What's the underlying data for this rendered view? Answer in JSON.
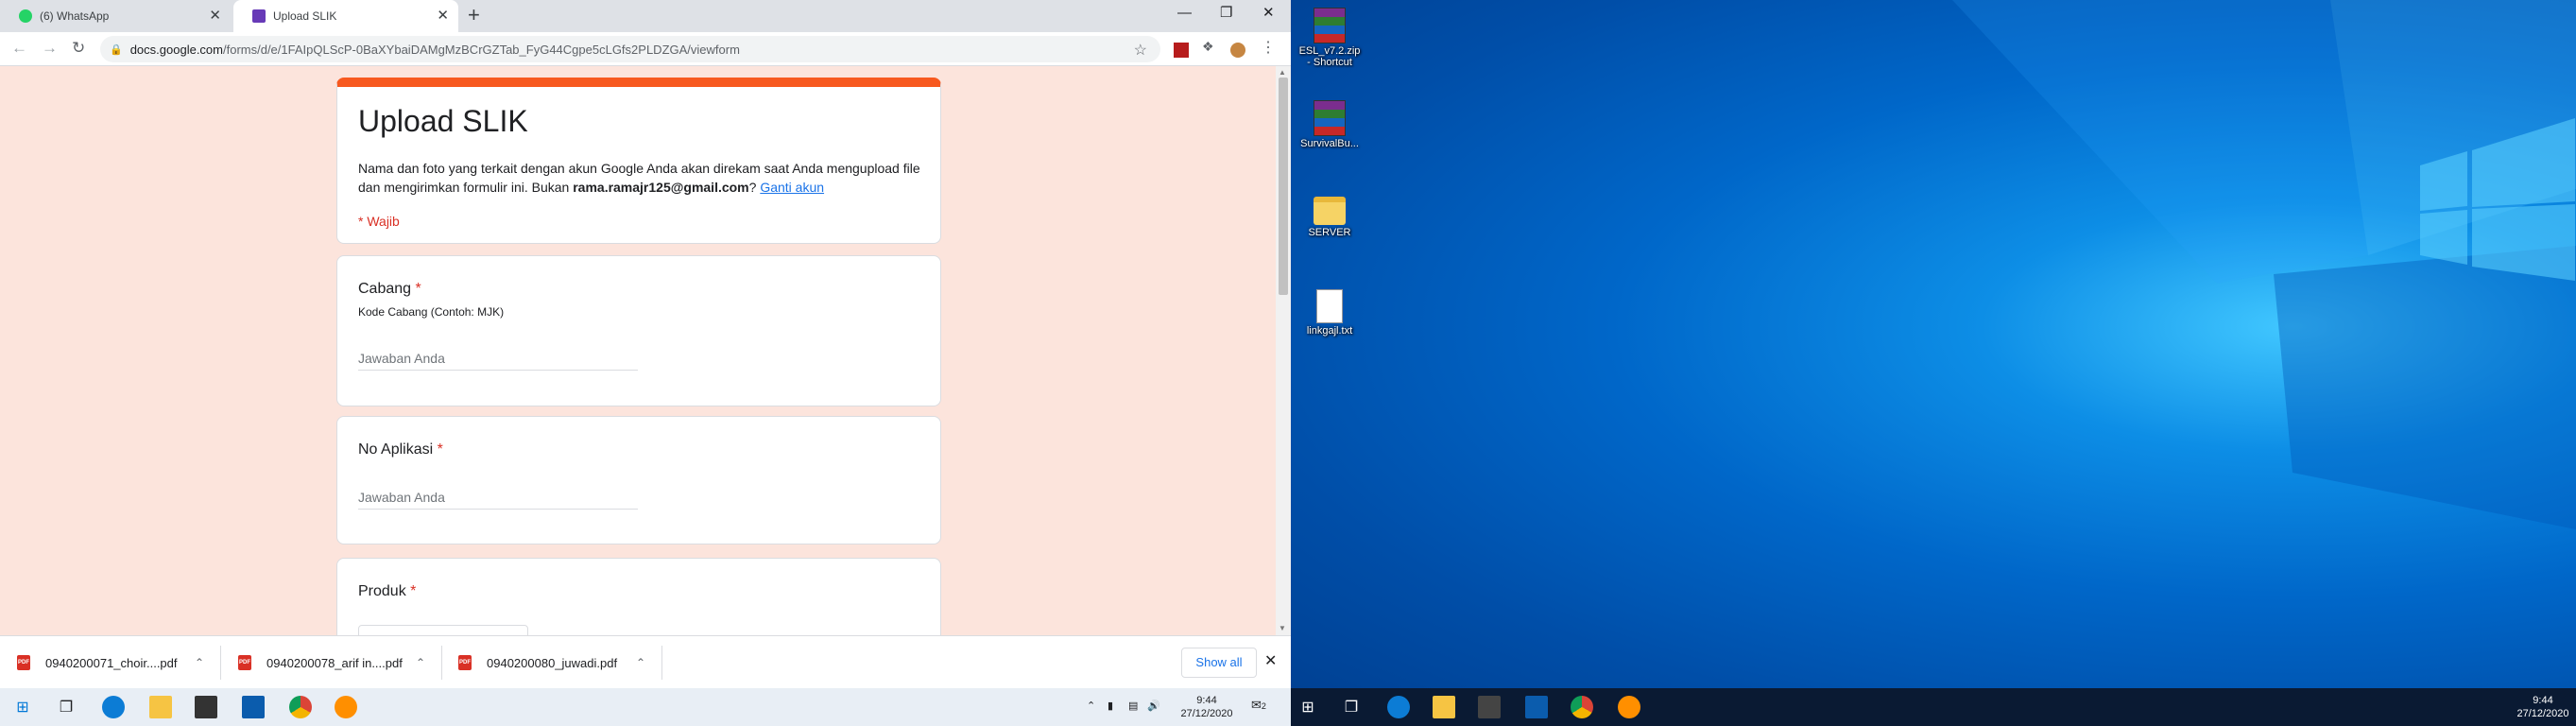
{
  "browser": {
    "tabs": [
      {
        "label": "(6) WhatsApp",
        "close": "✕"
      },
      {
        "label": "Upload SLIK",
        "close": "✕"
      }
    ],
    "new_tab": "+",
    "window_controls": {
      "minimize": "—",
      "maximize": "❐",
      "close": "✕"
    },
    "nav": {
      "back": "←",
      "forward": "→",
      "reload": "↻"
    },
    "url_host": "docs.google.com",
    "url_path": "/forms/d/e/1FAIpQLScP-0BaXYbaiDAMgMzBCrGZTab_FyG44Cgpe5cLGfs2PLDZGA/viewform",
    "star": "☆",
    "menu": "⋮"
  },
  "form": {
    "title": "Upload SLIK",
    "desc_part1": "Nama dan foto yang terkait dengan akun Google Anda akan direkam saat Anda mengupload file dan mengirimkan formulir ini. Bukan ",
    "desc_email": "rama.ramajr125@gmail.com",
    "desc_part2": "? ",
    "desc_link": "Ganti akun",
    "required_note": "* Wajib",
    "questions": [
      {
        "title": "Cabang",
        "req": "*",
        "help": "Kode Cabang (Contoh: MJK)",
        "placeholder": "Jawaban Anda"
      },
      {
        "title": "No Aplikasi",
        "req": "*",
        "help": "",
        "placeholder": "Jawaban Anda"
      },
      {
        "title": "Produk",
        "req": "*",
        "help": "",
        "placeholder": ""
      }
    ]
  },
  "downloads": {
    "items": [
      {
        "name": "0940200071_choir....pdf",
        "icon": "PDF"
      },
      {
        "name": "0940200078_arif in....pdf",
        "icon": "PDF"
      },
      {
        "name": "0940200080_juwadi.pdf",
        "icon": "PDF"
      }
    ],
    "show_all": "Show all",
    "close": "✕"
  },
  "taskbar_left": {
    "time": "9:44",
    "date": "27/12/2020",
    "notif_count": "2"
  },
  "desktop": {
    "icons": [
      {
        "label": "ESL_v7.2.zip - Shortcut"
      },
      {
        "label": "SurvivalBu..."
      },
      {
        "label": "SERVER"
      },
      {
        "label": "linkgajl.txt"
      }
    ]
  },
  "taskbar_right": {
    "time": "9:44",
    "date": "27/12/2020"
  },
  "colors": {
    "form_accent": "#f7591f",
    "form_bg": "#fce4dc",
    "required": "#d93025",
    "link": "#1a73e8"
  }
}
